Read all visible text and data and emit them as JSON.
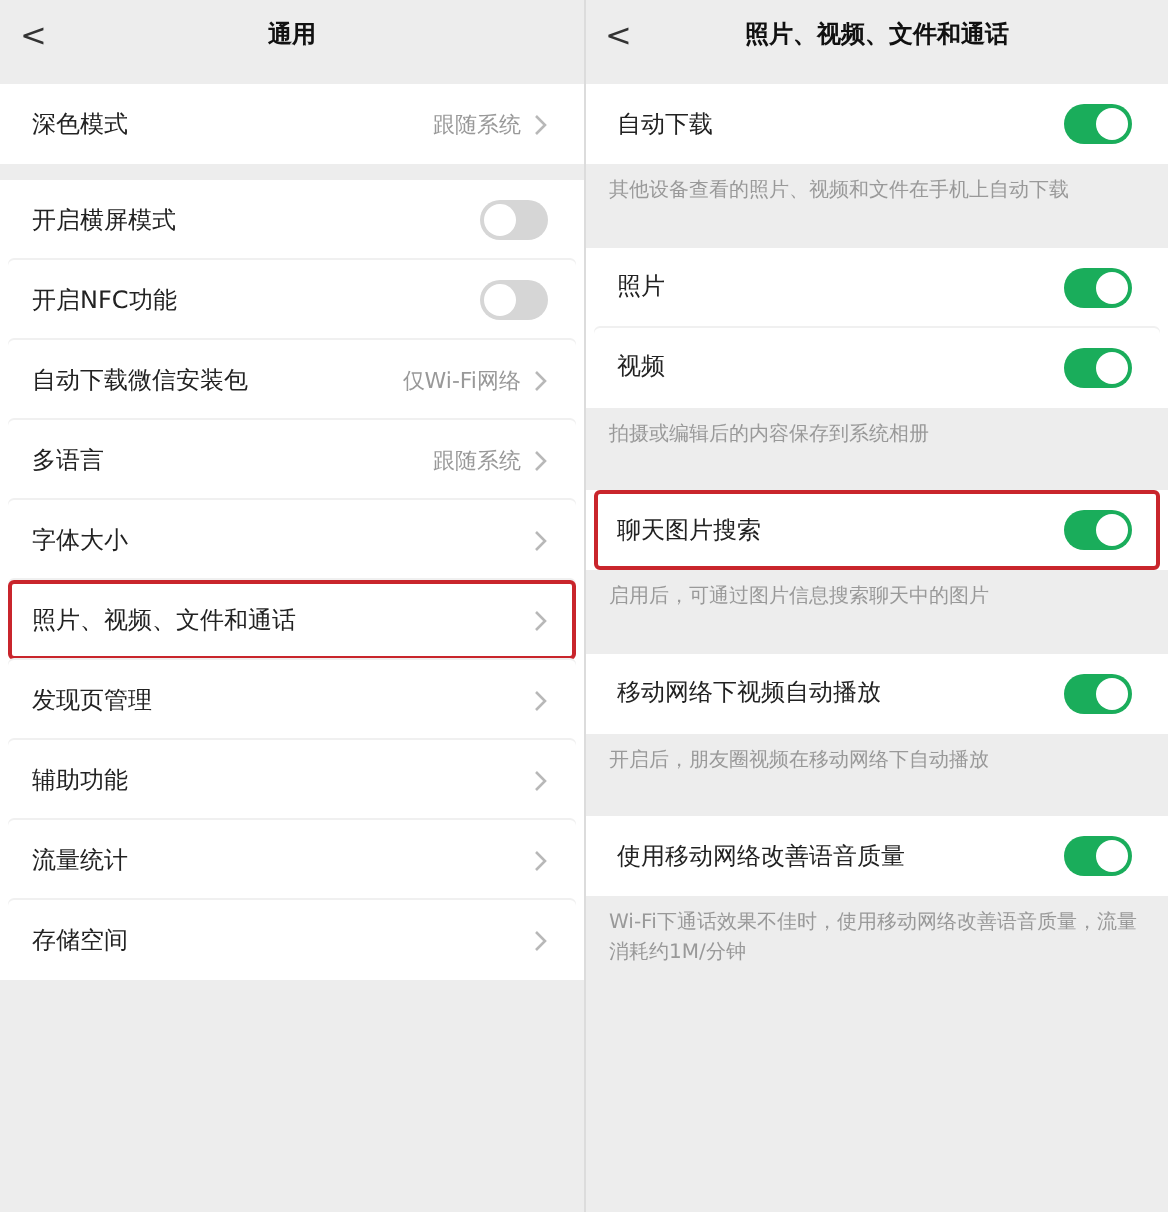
{
  "left": {
    "header": {
      "back": "<",
      "title": "通用"
    },
    "groups": [
      {
        "rows": [
          {
            "kind": "link",
            "label": "深色模式",
            "value": "跟随系统",
            "highlighted": false
          }
        ]
      },
      {
        "rows": [
          {
            "kind": "toggle",
            "label": "开启横屏模式",
            "on": false,
            "highlighted": false
          },
          {
            "kind": "toggle",
            "label": "开启NFC功能",
            "on": false,
            "highlighted": false
          },
          {
            "kind": "link",
            "label": "自动下载微信安装包",
            "value": "仅Wi-Fi网络",
            "highlighted": false
          },
          {
            "kind": "link",
            "label": "多语言",
            "value": "跟随系统",
            "highlighted": false
          },
          {
            "kind": "link",
            "label": "字体大小",
            "highlighted": false
          },
          {
            "kind": "link",
            "label": "照片、视频、文件和通话",
            "highlighted": true
          },
          {
            "kind": "link",
            "label": "发现页管理",
            "highlighted": false
          },
          {
            "kind": "link",
            "label": "辅助功能",
            "highlighted": false
          },
          {
            "kind": "link",
            "label": "流量统计",
            "highlighted": false
          },
          {
            "kind": "link",
            "label": "存储空间",
            "highlighted": false
          }
        ]
      }
    ]
  },
  "right": {
    "header": {
      "back": "<",
      "title": "照片、视频、文件和通话"
    },
    "groups": [
      {
        "rows": [
          {
            "kind": "toggle",
            "label": "自动下载",
            "on": true,
            "highlighted": false
          }
        ],
        "note": "其他设备查看的照片、视频和文件在手机上自动下载"
      },
      {
        "rows": [
          {
            "kind": "toggle",
            "label": "照片",
            "on": true,
            "highlighted": false
          },
          {
            "kind": "toggle",
            "label": "视频",
            "on": true,
            "highlighted": false
          }
        ],
        "note": "拍摄或编辑后的内容保存到系统相册"
      },
      {
        "rows": [
          {
            "kind": "toggle",
            "label": "聊天图片搜索",
            "on": true,
            "highlighted": true
          }
        ],
        "note": "启用后，可通过图片信息搜索聊天中的图片"
      },
      {
        "rows": [
          {
            "kind": "toggle",
            "label": "移动网络下视频自动播放",
            "on": true,
            "highlighted": false
          }
        ],
        "note": "开启后，朋友圈视频在移动网络下自动播放"
      },
      {
        "rows": [
          {
            "kind": "toggle",
            "label": "使用移动网络改善语音质量",
            "on": true,
            "highlighted": false
          }
        ],
        "note": "Wi-Fi下通话效果不佳时，使用移动网络改善语音质量，流量消耗约1M/分钟"
      }
    ]
  }
}
